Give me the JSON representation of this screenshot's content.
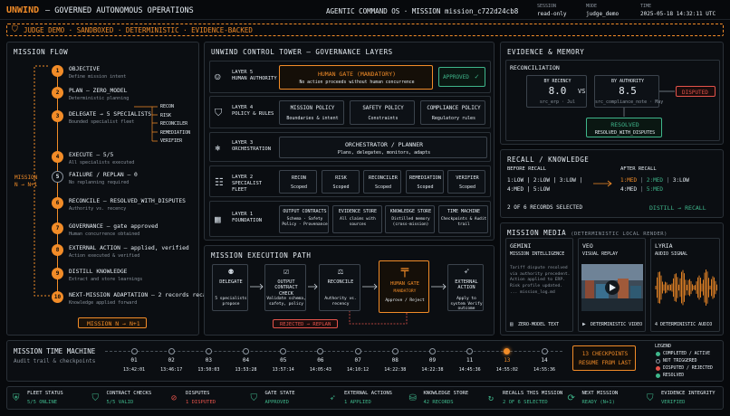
{
  "header": {
    "brand": "UNWIND",
    "subtitle": "— GOVERNED AUTONOMOUS OPERATIONS",
    "center": "AGENTIC COMMAND OS · MISSION mission_c722d24cb8",
    "session_label": "SESSION",
    "session": "read-only",
    "mode_label": "MODE",
    "mode": "judge_demo",
    "time_label": "TIME",
    "time": "2025-05-18 14:32:11 UTC"
  },
  "banner": {
    "text": "JUDGE DEMO · SANDBOXED · DETERMINISTIC · EVIDENCE-BACKED"
  },
  "flow": {
    "title": "MISSION FLOW",
    "loop_label": "MISSION",
    "loop_sub": "N → N+1",
    "steps": [
      {
        "n": "1",
        "title": "OBJECTIVE",
        "sub": "Define mission intent"
      },
      {
        "n": "2",
        "title": "PLAN — ZERO_MODEL",
        "sub": "Deterministic planning"
      },
      {
        "n": "3",
        "title": "DELEGATE → 5 SPECIALISTS",
        "sub": "Bounded specialist fleet"
      },
      {
        "n": "4",
        "title": "EXECUTE — 5/5",
        "sub": "All specialists executed"
      },
      {
        "n": "5",
        "title": "FAILURE / REPLAN — 0",
        "sub": "No replanning required"
      },
      {
        "n": "6",
        "title": "RECONCILE — RESOLVED_WITH_DISPUTES",
        "sub": "Authority vs. recency"
      },
      {
        "n": "7",
        "title": "GOVERNANCE — gate approved",
        "sub": "Human concurrence obtained"
      },
      {
        "n": "8",
        "title": "EXTERNAL ACTION — applied, verified",
        "sub": "Action executed & verified"
      },
      {
        "n": "9",
        "title": "DISTILL KNOWLEDGE",
        "sub": "Extract and store learnings"
      },
      {
        "n": "10",
        "title": "NEXT-MISSION ADAPTATION — 2 records recalled",
        "sub": "Knowledge applied forward"
      }
    ],
    "specialists": [
      "RECON",
      "RISK",
      "RECONCILER",
      "REMEDIATION",
      "VERIFIER"
    ],
    "next_button": "MISSION N → N+1"
  },
  "tower": {
    "title": "UNWIND CONTROL TOWER — GOVERNANCE LAYERS",
    "layers": [
      {
        "name": "LAYER 5",
        "desc": "HUMAN AUTHORITY"
      },
      {
        "name": "LAYER 4",
        "desc": "POLICY & RULES"
      },
      {
        "name": "LAYER 3",
        "desc": "ORCHESTRATION"
      },
      {
        "name": "LAYER 2",
        "desc": "SPECIALIST FLEET"
      },
      {
        "name": "LAYER 1",
        "desc": "FOUNDATION"
      }
    ],
    "human_gate": {
      "title": "HUMAN GATE (MANDATORY)",
      "sub": "No action proceeds without human concurrence",
      "status": "APPROVED"
    },
    "policies": [
      {
        "t": "MISSION POLICY",
        "s": "Boundaries & intent"
      },
      {
        "t": "SAFETY POLICY",
        "s": "Constraints"
      },
      {
        "t": "COMPLIANCE POLICY",
        "s": "Regulatory rules"
      }
    ],
    "orchestrator": {
      "t": "ORCHESTRATOR / PLANNER",
      "s": "Plans, delegates, monitors, adapts"
    },
    "fleet": [
      {
        "t": "RECON",
        "s": "Scoped"
      },
      {
        "t": "RISK",
        "s": "Scoped"
      },
      {
        "t": "RECONCILER",
        "s": "Scoped"
      },
      {
        "t": "REMEDIATION",
        "s": "Scoped"
      },
      {
        "t": "VERIFIER",
        "s": "Scoped"
      }
    ],
    "foundation": [
      {
        "t": "OUTPUT CONTRACTS",
        "s": "Schema · Safety Policy · Provenance"
      },
      {
        "t": "EVIDENCE STORE",
        "s": "All claims with sources"
      },
      {
        "t": "KNOWLEDGE STORE",
        "s": "Distilled memory (cross-mission)"
      },
      {
        "t": "TIME MACHINE",
        "s": "Checkpoints & Audit trail"
      }
    ]
  },
  "path": {
    "title": "MISSION EXECUTION PATH",
    "nodes": [
      {
        "t": "DELEGATE",
        "s": "5 specialists propose"
      },
      {
        "t": "OUTPUT CONTRACT CHECK",
        "s": "Validate schema, safety, policy"
      },
      {
        "t": "RECONCILE",
        "s": "Authority vs. recency"
      },
      {
        "t": "HUMAN GATE",
        "s2": "MANDATORY",
        "s": "Approve / Reject"
      },
      {
        "t": "EXTERNAL ACTION",
        "s": "Apply to system Verify outcome"
      }
    ],
    "rejected": "REJECTED → REPLAN"
  },
  "evidence": {
    "title": "EVIDENCE & MEMORY",
    "recon_title": "RECONCILIATION",
    "by_recency": {
      "label": "BY RECENCY",
      "value": "8.0",
      "src": "src_erp · Jul"
    },
    "vs": "VS",
    "by_authority": {
      "label": "BY AUTHORITY",
      "value": "8.5",
      "src": "src_compliance_note · May"
    },
    "disputed": "DISPUTED",
    "resolved": "RESOLVED",
    "resolved_sub": "RESOLVED_WITH_DISPUTES"
  },
  "recall": {
    "title": "RECALL / KNOWLEDGE",
    "before": "BEFORE RECALL",
    "after": "AFTER RECALL",
    "before_rows": [
      "1:LOW | 2:LOW | 3:LOW |",
      "4:MED | 5:LOW"
    ],
    "after_rows": [
      [
        "1:MED",
        "2:MED",
        "3:LOW"
      ],
      [
        "4:MED",
        "5:MED"
      ]
    ],
    "count": "2 OF 6 RECORDS SELECTED",
    "distill": "DISTILL → RECALL"
  },
  "media": {
    "title": "MISSION MEDIA",
    "title_sub": "(DETERMINISTIC LOCAL RENDER)",
    "cards": [
      {
        "name": "GEMINI",
        "sub": "MISSION INTELLIGENCE",
        "body": "Tariff dispute resolved via authority precedent. Action applied to ERP. Risk profile updated. ... mission_log.md",
        "footer": "ZERO-MODEL TEXT"
      },
      {
        "name": "VEO",
        "sub": "VISUAL REPLAY",
        "footer": "DETERMINISTIC VIDEO"
      },
      {
        "name": "LYRIA",
        "sub": "AUDIO SIGNAL",
        "footer": "4 DETERMINISTIC AUDIO"
      }
    ]
  },
  "timemachine": {
    "title": "MISSION TIME MACHINE",
    "sub": "Audit trail & checkpoints",
    "points": [
      {
        "n": "01",
        "t": "13:42:01"
      },
      {
        "n": "02",
        "t": "13:46:17"
      },
      {
        "n": "03",
        "t": "13:50:03"
      },
      {
        "n": "04",
        "t": "13:53:28"
      },
      {
        "n": "05",
        "t": "13:57:14"
      },
      {
        "n": "06",
        "t": "14:05:43"
      },
      {
        "n": "07",
        "t": "14:10:12"
      },
      {
        "n": "08",
        "t": "14:22:38"
      },
      {
        "n": "09",
        "t": "14:22:38"
      },
      {
        "n": "11",
        "t": "14:45:36"
      },
      {
        "n": "13",
        "t": "14:55:02"
      },
      {
        "n": "14",
        "t": "14:55:36"
      }
    ],
    "active_index": 10,
    "resume": [
      "13 CHECKPOINTS",
      "RESUME FROM LAST"
    ],
    "legend_title": "LEGEND",
    "legend": [
      "COMPLETED / ACTIVE",
      "NOT TRIGGERED",
      "DISPUTED / REJECTED",
      "RESOLVED"
    ]
  },
  "status": [
    {
      "l": "FLEET STATUS",
      "v": "5/5 ONLINE"
    },
    {
      "l": "CONTRACT CHECKS",
      "v": "5/5 VALID"
    },
    {
      "l": "DISPUTES",
      "v": "1 DISPUTED"
    },
    {
      "l": "GATE STATE",
      "v": "APPROVED"
    },
    {
      "l": "EXTERNAL ACTIONS",
      "v": "1 APPLIED"
    },
    {
      "l": "KNOWLEDGE STORE",
      "v": "42 RECORDS"
    },
    {
      "l": "RECALLS THIS MISSION",
      "v": "2 OF 6 SELECTED"
    },
    {
      "l": "NEXT MISSION",
      "v": "READY (N+1)"
    },
    {
      "l": "EVIDENCE INTEGRITY",
      "v": "VERIFIED"
    }
  ],
  "colors": {
    "accent": "#f28c28",
    "ok": "#3fb68b",
    "bad": "#e5534b",
    "bg": "#07090c"
  }
}
